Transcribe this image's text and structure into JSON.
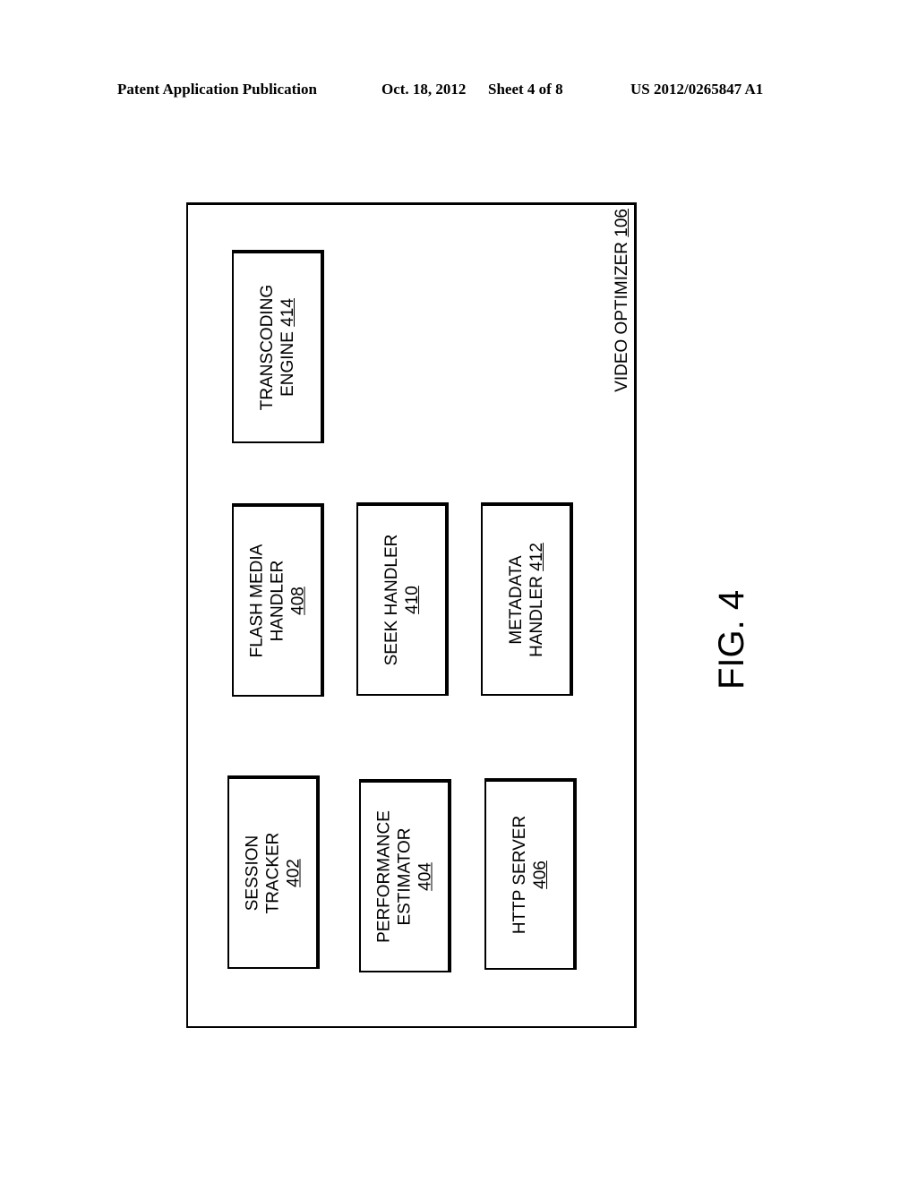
{
  "header": {
    "publication": "Patent Application Publication",
    "date": "Oct. 18, 2012",
    "sheet": "Sheet 4 of 8",
    "number": "US 2012/0265847 A1"
  },
  "diagram": {
    "container": {
      "label": "VIDEO OPTIMIZER",
      "ref": "106"
    },
    "components": [
      {
        "id": "session-tracker",
        "lines": [
          "SESSION",
          "TRACKER"
        ],
        "ref": "402"
      },
      {
        "id": "performance-estimator",
        "lines": [
          "PERFORMANCE",
          "ESTIMATOR"
        ],
        "ref": "404"
      },
      {
        "id": "http-server",
        "lines": [
          "HTTP SERVER"
        ],
        "ref": "406"
      },
      {
        "id": "flash-media-handler",
        "lines": [
          "FLASH MEDIA",
          "HANDLER"
        ],
        "ref": "408"
      },
      {
        "id": "seek-handler",
        "lines": [
          "SEEK HANDLER"
        ],
        "ref": "410"
      },
      {
        "id": "metadata-handler",
        "lines": [
          "METADATA",
          "HANDLER"
        ],
        "ref": "412"
      },
      {
        "id": "transcoding-engine",
        "lines": [
          "TRANSCODING",
          "ENGINE"
        ],
        "ref": "414"
      }
    ]
  },
  "figure_label": "FIG. 4"
}
